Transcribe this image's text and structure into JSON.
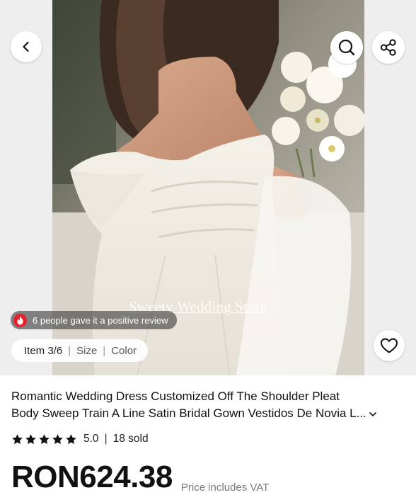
{
  "gallery": {
    "watermark": "Sweety Wedding Store",
    "review_text": "6 people gave it a positive review",
    "item_label": "Item 3/6",
    "size_label": "Size",
    "color_label": "Color"
  },
  "icons": {
    "back": "chevron-left-icon",
    "search": "search-icon",
    "share": "share-icon",
    "wishlist": "heart-icon",
    "review": "fire-icon",
    "expand": "chevron-down-icon",
    "star": "star-icon"
  },
  "product": {
    "title_line1": "Romantic Wedding Dress Customized Off The Shoulder Pleat",
    "title_line2": "Body Sweep Train A Line Satin Bridal Gown Vestidos De Novia L...",
    "rating": "5.0",
    "sold": "18 sold",
    "stars_filled": 5,
    "price": "RON624.38",
    "price_note": "Price includes VAT"
  },
  "colors": {
    "fire_badge": "#e8212f",
    "price_text": "#111111",
    "muted_text": "#7a7a7a"
  }
}
